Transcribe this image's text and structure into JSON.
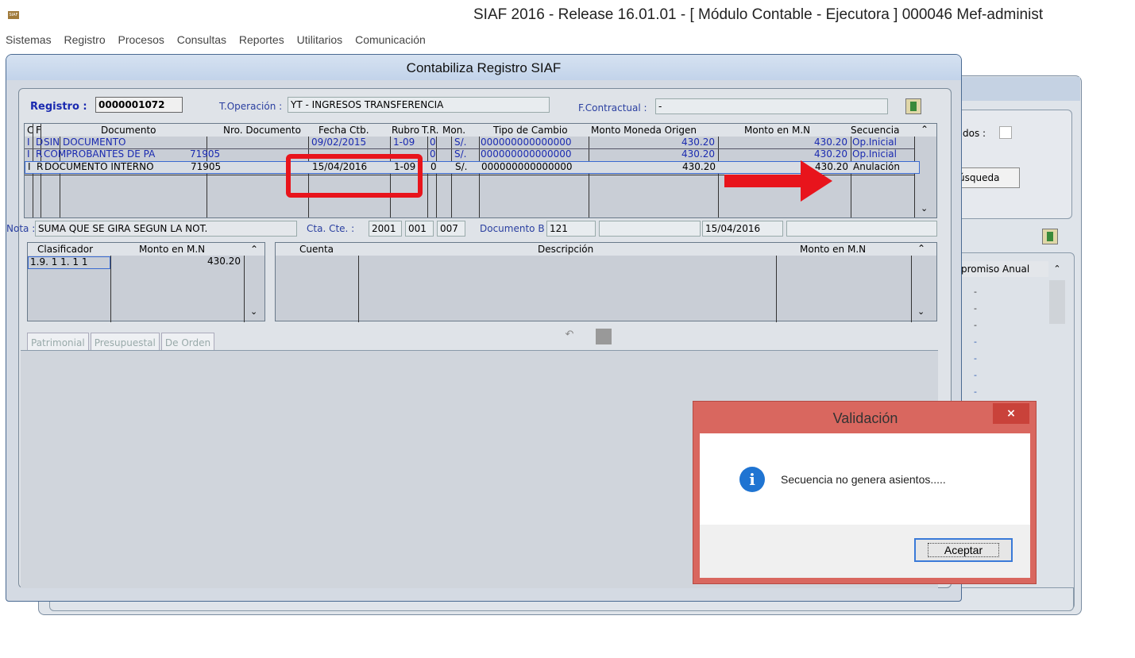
{
  "app": {
    "title": "SIAF 2016 - Release 16.01.01 - [ Módulo Contable - Ejecutora ] 000046 Mef-administ",
    "icon_label": "SIAF"
  },
  "menu": [
    "Sistemas",
    "Registro",
    "Procesos",
    "Consultas",
    "Reportes",
    "Utilitarios",
    "Comunicación"
  ],
  "background": {
    "label_dos": "dos :",
    "busqueda_button": "úsqueda",
    "column_header": "promiso Anual",
    "dash": "-"
  },
  "window": {
    "title": "Contabiliza Registro SIAF",
    "registro_label": "Registro :",
    "registro_value": "0000001072",
    "toperacion_label": "T.Operación :",
    "toperacion_value": "YT - INGRESOS TRANSFERENCIA",
    "fcontractual_label": "F.Contractual :",
    "fcontractual_value": "-"
  },
  "grid": {
    "headers": [
      "C",
      "F",
      "Documento",
      "Nro. Documento",
      "Fecha Ctb.",
      "Rubro",
      "T.R.",
      "Mon.",
      "Tipo de Cambio",
      "Monto Moneda Origen",
      "Monto en M.N",
      "Secuencia"
    ],
    "rows": [
      {
        "c": "I",
        "f": "D",
        "doc": "SIN DOCUMENTO",
        "nro": "",
        "fecha": "09/02/2015",
        "rubro": "1-09",
        "tr": "0",
        "mon": "S/.",
        "tc": "000000000000000",
        "mmo": "430.20",
        "mmn": "430.20",
        "sec": "Op.Inicial"
      },
      {
        "c": "I",
        "f": "R",
        "doc": "COMPROBANTES DE PA",
        "nro": "71905",
        "fecha": "",
        "rubro": "",
        "tr": "0",
        "mon": "S/.",
        "tc": "000000000000000",
        "mmo": "430.20",
        "mmn": "430.20",
        "sec": "Op.Inicial"
      },
      {
        "c": "I",
        "f": "R",
        "doc": "DOCUMENTO INTERNO",
        "nro": "71905",
        "fecha": "15/04/2016",
        "rubro": "1-09",
        "tr": "0",
        "mon": "S/.",
        "tc": "000000000000000",
        "mmo": "430.20",
        "mmn": "430.20",
        "sec": "Anulación"
      }
    ]
  },
  "nota": {
    "label": "Nota :",
    "value": "SUMA QUE SE GIRA SEGUN LA NOT.",
    "ctacte_label": "Cta. Cte. :",
    "ctacte_1": "2001",
    "ctacte_2": "001",
    "ctacte_3": "007",
    "docb_label": "Documento B :",
    "docb_value": "121",
    "date": "15/04/2016"
  },
  "clasificador": {
    "headers": [
      "Clasificador",
      "Monto en M.N"
    ],
    "rows": [
      {
        "clasificador": "1.9. 1 1. 1 1",
        "monto": "430.20"
      }
    ]
  },
  "cuentas": {
    "headers": [
      "Cuenta",
      "Descripción",
      "Monto en M.N"
    ]
  },
  "tabs": [
    "Patrimonial",
    "Presupuestal",
    "De Orden"
  ],
  "dialog": {
    "title": "Validación",
    "close": "×",
    "message": "Secuencia no genera asientos.....",
    "button": "Aceptar",
    "icon": "i"
  },
  "colors": {
    "highlight_red": "#e8141c",
    "grid_blue_text": "#1a2ab0",
    "dialog_border": "#d9675f",
    "info_icon": "#1f74d2"
  }
}
